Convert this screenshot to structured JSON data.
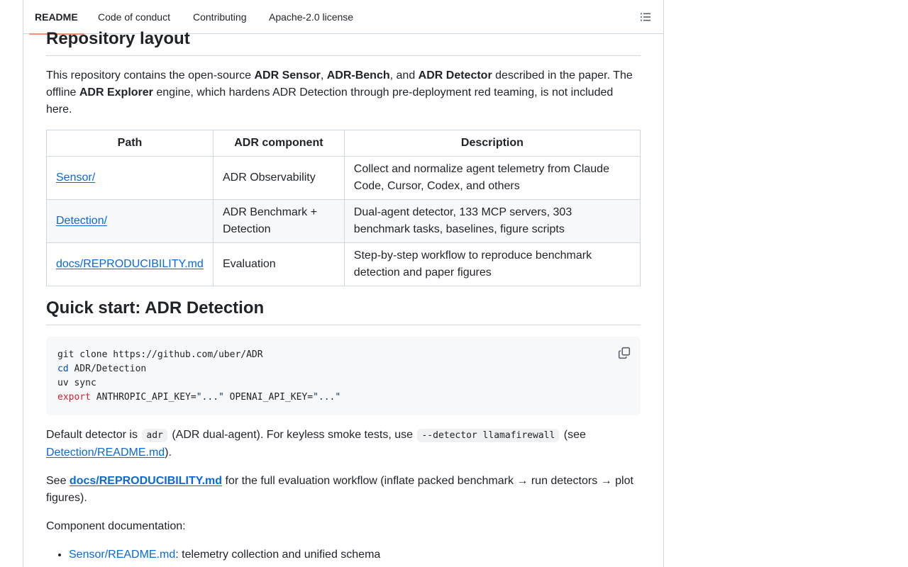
{
  "tabs": [
    {
      "label": "README",
      "active": true
    },
    {
      "label": "Code of conduct",
      "active": false
    },
    {
      "label": "Contributing",
      "active": false
    },
    {
      "label": "Apache-2.0 license",
      "active": false
    }
  ],
  "outline_icon": "list-unordered-icon",
  "copy_icon": "copy-icon",
  "section1": {
    "heading": "Repository layout",
    "intro": {
      "t1": "This repository contains the open-source ",
      "b1": "ADR Sensor",
      "t2": ", ",
      "b2": "ADR-Bench",
      "t3": ", and ",
      "b3": "ADR Detector",
      "t4": " described in the paper. The offline ",
      "b4": "ADR Explorer",
      "t5": " engine, which hardens ADR Detection through pre-deployment red teaming, is not included here."
    },
    "table": {
      "headers": [
        "Path",
        "ADR component",
        "Description"
      ],
      "rows": [
        {
          "path": "Sensor/",
          "component": "ADR Observability",
          "description": "Collect and normalize agent telemetry from Claude Code, Cursor, Codex, and others"
        },
        {
          "path": "Detection/",
          "component": "ADR Benchmark + Detection",
          "description": "Dual-agent detector, 133 MCP servers, 303 benchmark tasks, baselines, figure scripts"
        },
        {
          "path": "docs/REPRODUCIBILITY.md",
          "component": "Evaluation",
          "description": "Step-by-step workflow to reproduce benchmark detection and paper figures"
        }
      ]
    }
  },
  "section2": {
    "heading": "Quick start: ADR Detection",
    "code": {
      "line1": "git clone https://github.com/uber/ADR",
      "line2_kw": "cd",
      "line2_rest": " ADR/Detection",
      "line3": "uv sync",
      "line4_kw": "export",
      "line4_a": " ANTHROPIC_API_KEY=",
      "line4_s1": "\"...\"",
      "line4_b": " OPENAI_API_KEY=",
      "line4_s2": "\"...\""
    },
    "default_para": {
      "t1": "Default detector is ",
      "c1": "adr",
      "t2": " (ADR dual-agent). For keyless smoke tests, use ",
      "c2": "--detector llamafirewall",
      "t3": " (see ",
      "link": "Detection/README.md",
      "t4": ")."
    },
    "see_para": {
      "t1": "See ",
      "link": "docs/REPRODUCIBILITY.md",
      "t2": " for the full evaluation workflow (inflate packed benchmark ",
      "arrow1": "→",
      "t3": " run detectors ",
      "arrow2": "→",
      "t4": " plot figures)."
    },
    "component_docs": "Component documentation:",
    "docs_list": [
      {
        "link": "Sensor/README.md",
        "text": ": telemetry collection and unified schema"
      }
    ]
  },
  "colors": {
    "link": "#0969da",
    "active_tab_underline": "#fd8c73",
    "code_keyword_blue": "#0550ae",
    "code_keyword_red": "#cf222e",
    "code_string": "#0a3069"
  }
}
